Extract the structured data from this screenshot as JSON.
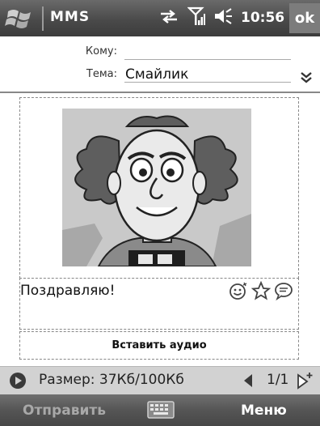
{
  "title_bar": {
    "app_title": "MMS",
    "time": "10:56",
    "ok_label": "ok",
    "icons": [
      "windows-start-icon",
      "connectivity-icon",
      "signal-icon",
      "volume-icon"
    ]
  },
  "header": {
    "to_label": "Кому:",
    "to_value": "",
    "subject_label": "Тема:",
    "subject_value": "Смайлик",
    "expand_icon": "double-chevron-down-icon"
  },
  "content": {
    "picture": "cartoon-character-image",
    "message_text": "Поздравляю!",
    "tools": [
      "emoticon-icon",
      "star-icon",
      "text-bubble-icon"
    ],
    "insert_audio_label": "Вставить аудио"
  },
  "nav": {
    "size_text": "Размер: 37Кб/100Кб",
    "page_text": "1/1",
    "icons": [
      "play-icon",
      "previous-slide-icon",
      "next-slide-icon"
    ]
  },
  "softkeys": {
    "left_label": "Отправить",
    "right_label": "Меню",
    "center_icon": "keyboard-icon"
  },
  "colors": {
    "title_bar": "#4a4a4a",
    "nav_bar": "#d2d2d2",
    "softkey_disabled": "#a8a8a8"
  }
}
